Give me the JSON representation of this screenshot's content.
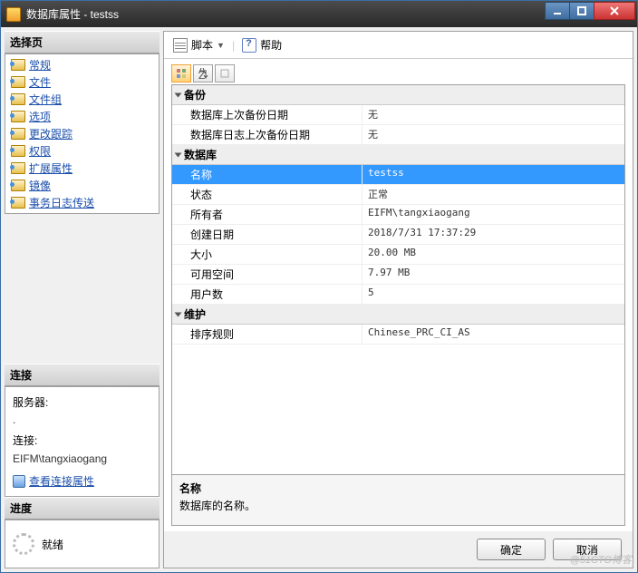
{
  "title": "数据库属性 - testss",
  "left": {
    "select_page": "选择页",
    "nav": [
      "常规",
      "文件",
      "文件组",
      "选项",
      "更改跟踪",
      "权限",
      "扩展属性",
      "镜像",
      "事务日志传送"
    ],
    "connection": {
      "heading": "连接",
      "server_lbl": "服务器:",
      "server_val": ".",
      "conn_lbl": "连接:",
      "conn_val": "EIFM\\tangxiaogang",
      "view_link": "查看连接属性"
    },
    "progress": {
      "heading": "进度",
      "status": "就绪"
    }
  },
  "toolbar": {
    "script": "脚本",
    "help": "帮助"
  },
  "grid": {
    "cats": [
      {
        "name": "备份",
        "rows": [
          {
            "k": "数据库上次备份日期",
            "v": "无"
          },
          {
            "k": "数据库日志上次备份日期",
            "v": "无"
          }
        ]
      },
      {
        "name": "数据库",
        "rows": [
          {
            "k": "名称",
            "v": "testss",
            "sel": true
          },
          {
            "k": "状态",
            "v": "正常"
          },
          {
            "k": "所有者",
            "v": "EIFM\\tangxiaogang"
          },
          {
            "k": "创建日期",
            "v": "2018/7/31 17:37:29"
          },
          {
            "k": "大小",
            "v": "20.00 MB"
          },
          {
            "k": "可用空间",
            "v": "7.97 MB"
          },
          {
            "k": "用户数",
            "v": "5"
          }
        ]
      },
      {
        "name": "维护",
        "rows": [
          {
            "k": "排序规则",
            "v": "Chinese_PRC_CI_AS"
          }
        ]
      }
    ],
    "desc": {
      "title": "名称",
      "body": "数据库的名称。"
    }
  },
  "buttons": {
    "ok": "确定",
    "cancel": "取消"
  },
  "watermark": "@51CTO博客"
}
